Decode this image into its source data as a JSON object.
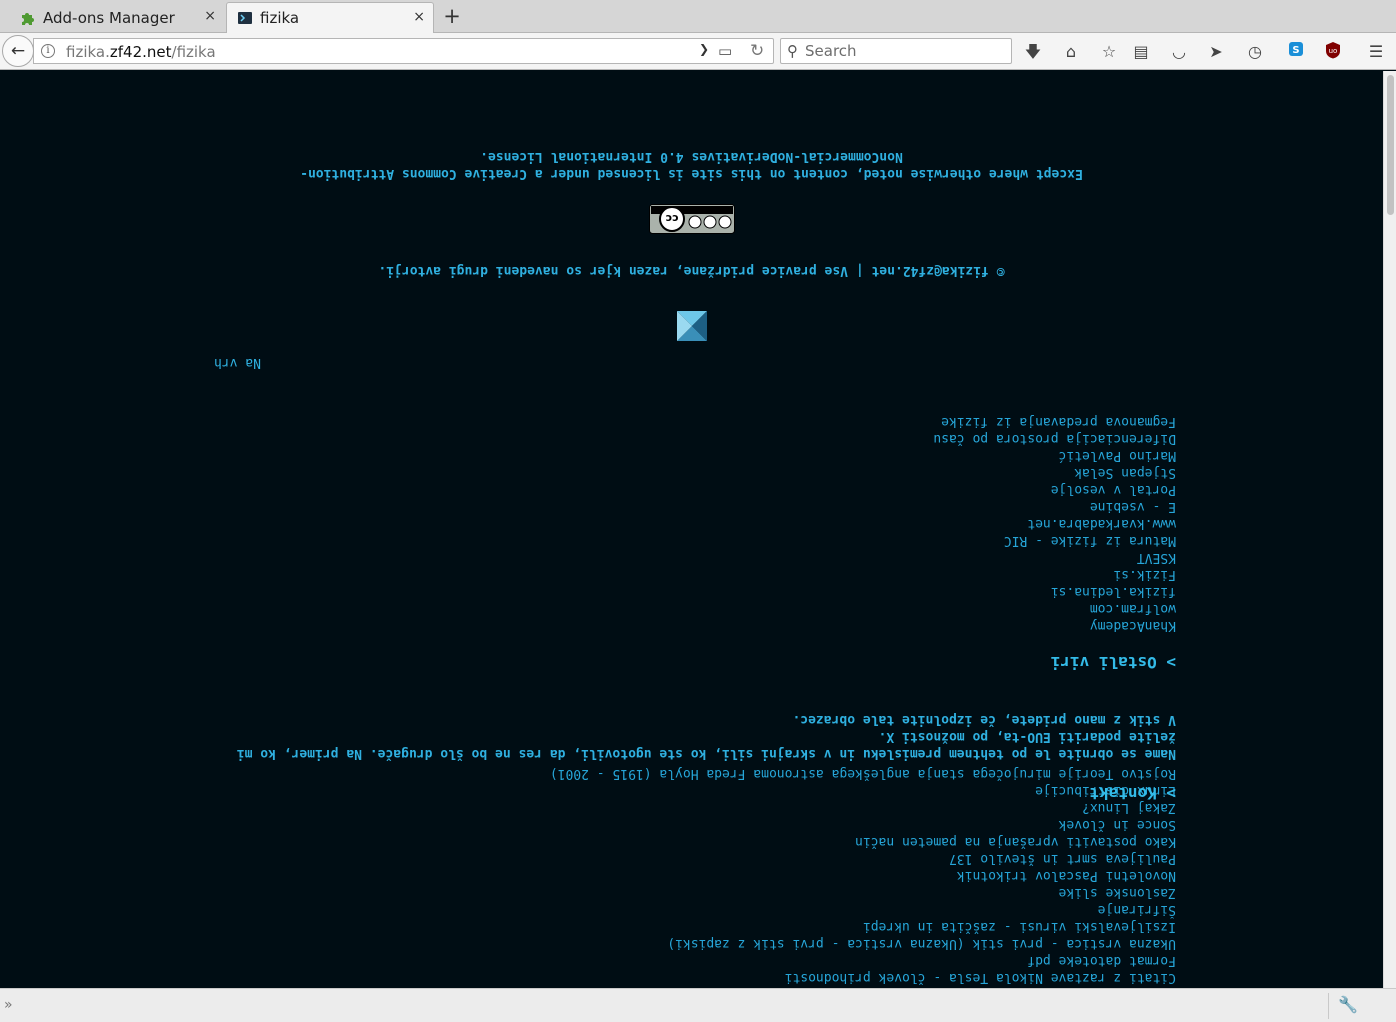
{
  "tabs": [
    {
      "title": "Add-ons Manager",
      "icon": "puzzle-piece-icon",
      "close": "×",
      "active": false
    },
    {
      "title": "fizika",
      "icon": "terminal-icon",
      "close": "×",
      "active": true
    }
  ],
  "new_tab_label": "+",
  "navbar": {
    "back_symbol": "←",
    "url_host": "fizika.zf42.net",
    "url_path": "/fizika",
    "url_prefix": "fizika.",
    "url_domain": "zf42.net",
    "search_placeholder": "Search",
    "icons": [
      "download-icon",
      "home-icon",
      "bookmark-star-icon",
      "reading-list-icon",
      "pocket-icon",
      "send-icon",
      "history-icon",
      "skype-icon",
      "ublock-icon",
      "menu-icon"
    ]
  },
  "page": {
    "license_line1": "Except where otherwise noted, content on this site is licensed under a Creative Commons Attribution-",
    "license_line2": "NonCommercial-NoDerivatives 4.0 International License.",
    "copyright": "© fizika@zf42.net | Vse pravice pridržane, razen kjer so navedeni drugi avtorji.",
    "back_to_top": "Na vrh",
    "other_sources_heading": "> Ostali viri",
    "other_sources": [
      "KhanAcademy",
      "wolfram.com",
      "fizika.ledina.si",
      "Fizik.si",
      "KSEVT",
      "Matura iz fizike - RIC",
      "www.kvarkadabra.net",
      "E - vsebine",
      "Portal v vesolje",
      "Stjepan Selak",
      "Marino Pavletić",
      "Diferenciacija prostora po času",
      "Fegmanova predavanja iz fizike"
    ],
    "contact_heading": "> Kontakt",
    "contact_text_1": "Name se obrnite le po tehtnem premisleku in v skrajni sili, ko ste ugotovili, da res ne bo šlo drugače. Na",
    "contact_text_2": "primer, ko mi želite podariti EUO-ta, po možnosti X.",
    "contact_text_3": "V stik z mano pridete, če izpolnite tale obrazec.",
    "articles": [
      "Citati z raztave Nikola Tesla - človek prihodnosti",
      "Format datoteke pdf",
      "Ukazna vrstica - prvi stik (Ukazna vrstica - prvi stik z zapiski)",
      "Izsiljevalski virusi - zaščita in ukrepi",
      "Šifriranje",
      "Zaslonske slike",
      "Novoletni Pascalov trikotnik",
      "Paulijeva smrt in število 137",
      "Kako postaviti vprašanja na pameten način",
      "Sonce in človek",
      "Zakaj Linux?",
      "Linux distribucije",
      "Rojstvo Teorije mirujočega stanja angleškega astronoma Freda Hoyla (1915 - 2001)"
    ]
  },
  "status_bar": {
    "close_symbol": "»",
    "wrench_icon": "wrench-icon"
  },
  "colors": {
    "page_background": "#000d14",
    "text": "#26a6d9",
    "heading": "#33bbe8"
  }
}
